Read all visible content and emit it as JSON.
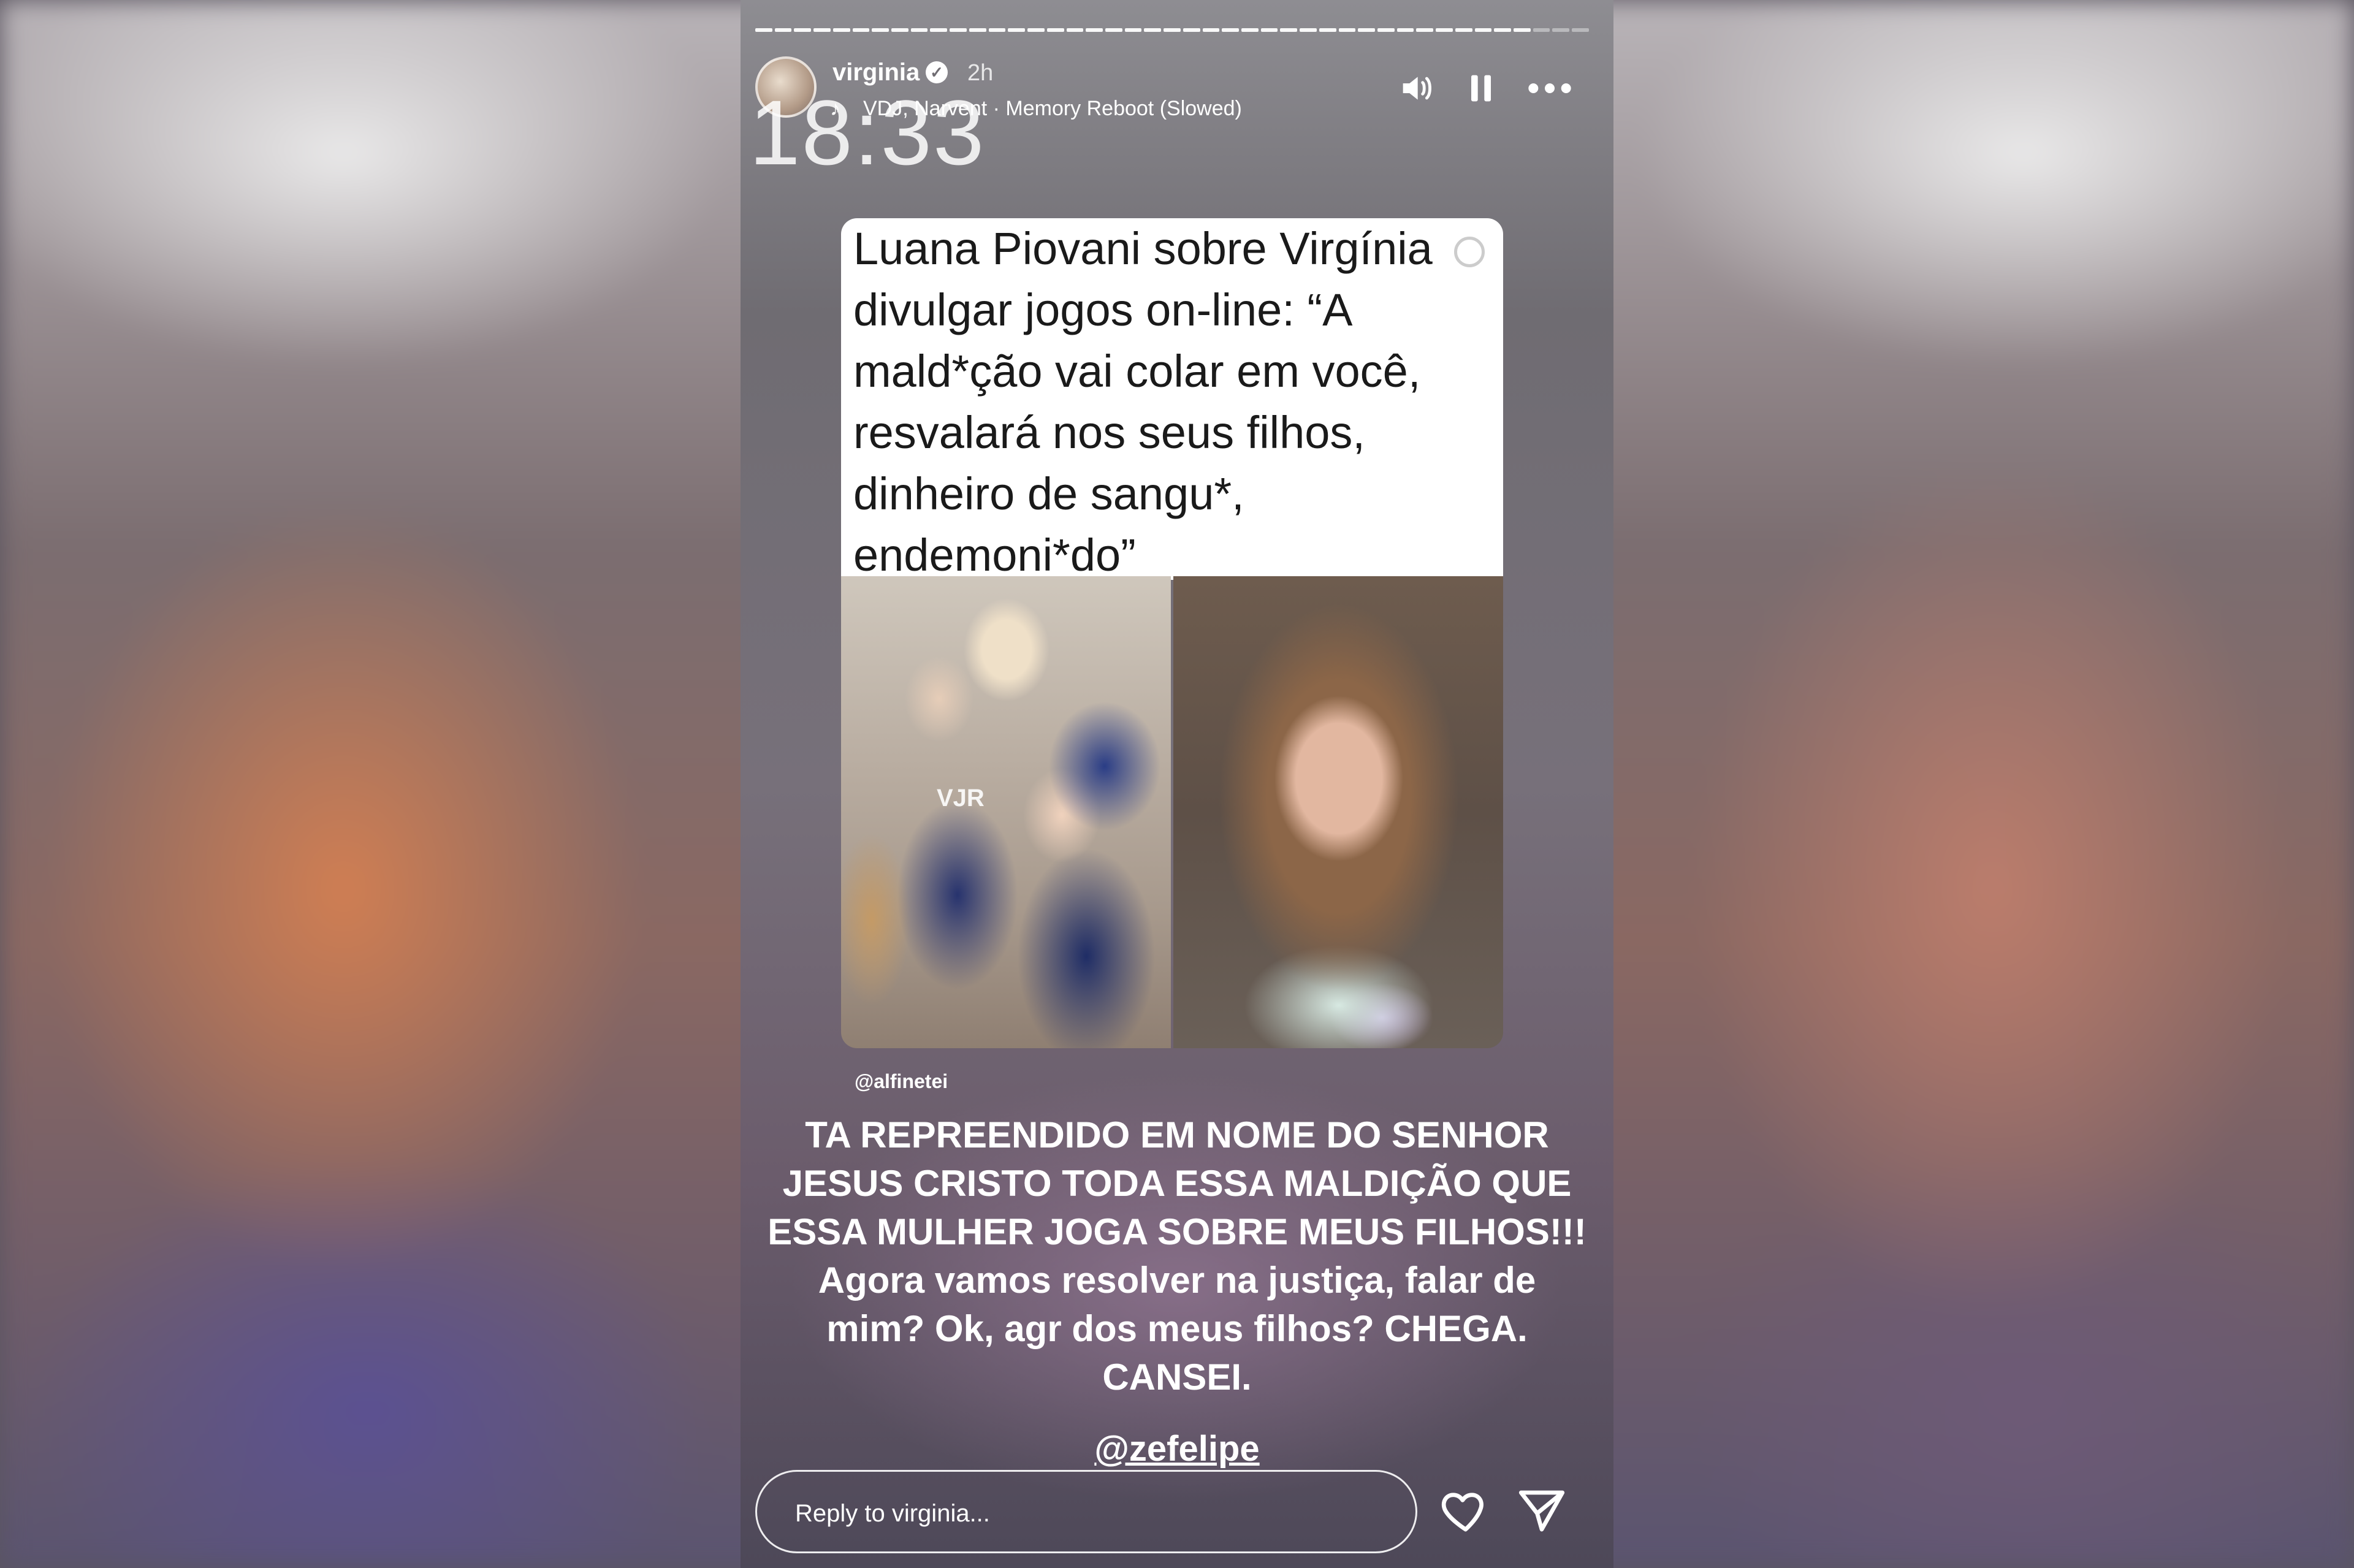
{
  "story": {
    "username": "virginia",
    "time_ago": "2h",
    "music": "VDJ, Narvent · Memory Reboot (Slowed)",
    "clock": "18:33",
    "card_text": "Luana Piovani sobre Virgínia divulgar jogos on-line: “A mald*ção vai colar em você, resvalará nos seus filhos, dinheiro de sangu*, endemoni*do”",
    "photo_left_logo": "VJR",
    "credit": "@alfinetei",
    "caption": "TA REPREENDIDO EM NOME DO SENHOR JESUS CRISTO TODA ESSA MALDIÇÃO QUE ESSA MULHER JOGA SOBRE MEUS FILHOS!!! Agora vamos resolver na justiça, falar de mim? Ok, agr dos meus filhos? CHEGA. CANSEI.",
    "mention": "@zefelipe",
    "reply_placeholder": "Reply to virginia..."
  },
  "icons": {
    "verified": "verified-badge-icon",
    "volume": "volume-icon",
    "pause": "pause-icon",
    "more": "more-options-icon",
    "heart": "heart-icon",
    "send": "send-icon",
    "music": "music-note-icon"
  },
  "colors": {
    "text": "#ffffff",
    "card_bg": "#ffffff",
    "card_text": "#1a1a1a"
  }
}
